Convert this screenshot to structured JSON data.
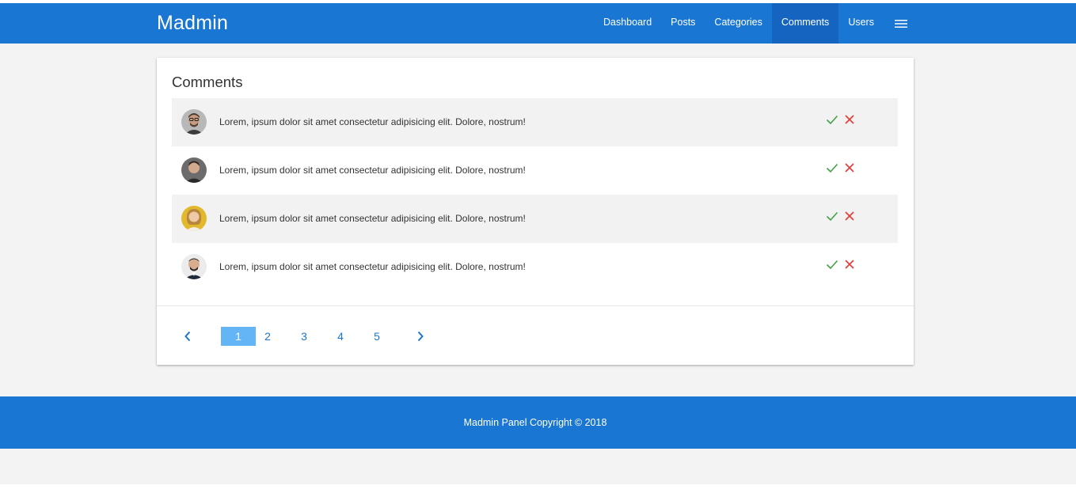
{
  "brand": "Madmin",
  "nav": {
    "items": [
      {
        "label": "Dashboard"
      },
      {
        "label": "Posts"
      },
      {
        "label": "Categories"
      },
      {
        "label": "Comments",
        "active": true
      },
      {
        "label": "Users"
      }
    ],
    "menu_icon": "hamburger-menu-icon"
  },
  "comments": {
    "title": "Comments",
    "rows": [
      {
        "avatar": "avatar-1",
        "text": "Lorem, ipsum dolor sit amet consectetur adipisicing elit. Dolore, nostrum!"
      },
      {
        "avatar": "avatar-2",
        "text": "Lorem, ipsum dolor sit amet consectetur adipisicing elit. Dolore, nostrum!"
      },
      {
        "avatar": "avatar-3",
        "text": "Lorem, ipsum dolor sit amet consectetur adipisicing elit. Dolore, nostrum!"
      },
      {
        "avatar": "avatar-4",
        "text": "Lorem, ipsum dolor sit amet consectetur adipisicing elit. Dolore, nostrum!"
      }
    ],
    "approve_icon": "check-icon",
    "reject_icon": "close-icon"
  },
  "pagination": {
    "pages": [
      "1",
      "2",
      "3",
      "4",
      "5"
    ],
    "current": "1",
    "prev_icon": "chevron-left-icon",
    "next_icon": "chevron-right-icon"
  },
  "footer": {
    "text": "Madmin Panel Copyright © 2018"
  },
  "colors": {
    "primary": "#1976d2",
    "active_nav": "#1565c0",
    "active_page": "#64b5f6",
    "approve": "#43a047",
    "reject": "#e53935"
  }
}
